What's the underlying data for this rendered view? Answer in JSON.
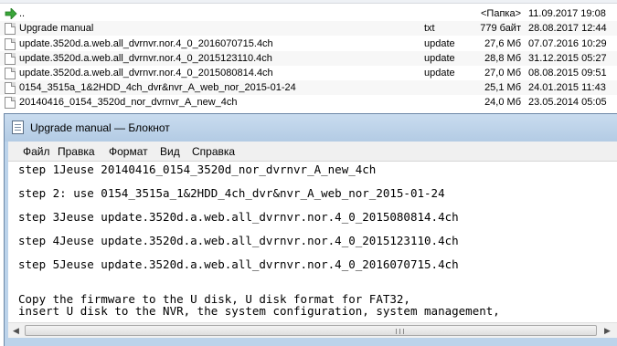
{
  "file_manager": {
    "rows": [
      {
        "name": "..",
        "type": "",
        "size": "<Папка>",
        "date": "11.09.2017 19:08",
        "kind": "up"
      },
      {
        "name": "Upgrade manual",
        "type": "txt",
        "size": "779 байт",
        "date": "28.08.2017 12:44",
        "kind": "file"
      },
      {
        "name": "update.3520d.a.web.all_dvrnvr.nor.4_0_2016070715.4ch",
        "type": "update",
        "size": "27,6 Мб",
        "date": "07.07.2016 10:29",
        "kind": "file"
      },
      {
        "name": "update.3520d.a.web.all_dvrnvr.nor.4_0_2015123110.4ch",
        "type": "update",
        "size": "28,8 Мб",
        "date": "31.12.2015 05:27",
        "kind": "file"
      },
      {
        "name": "update.3520d.a.web.all_dvrnvr.nor.4_0_2015080814.4ch",
        "type": "update",
        "size": "27,0 Мб",
        "date": "08.08.2015 09:51",
        "kind": "file"
      },
      {
        "name": "0154_3515a_1&2HDD_4ch_dvr&nvr_A_web_nor_2015-01-24",
        "type": "",
        "size": "25,1 Мб",
        "date": "24.01.2015 11:43",
        "kind": "file"
      },
      {
        "name": "20140416_0154_3520d_nor_dvrnvr_A_new_4ch",
        "type": "",
        "size": "24,0 Мб",
        "date": "23.05.2014 05:05",
        "kind": "file"
      }
    ]
  },
  "notepad": {
    "title": "Upgrade manual — Блокнот",
    "menu": [
      "Файл",
      "Правка",
      "Формат",
      "Вид",
      "Справка"
    ],
    "lines": [
      "step 1Jeuse 20140416_0154_3520d_nor_dvrnvr_A_new_4ch",
      "step 2: use 0154_3515a_1&2HDD_4ch_dvr&nvr_A_web_nor_2015-01-24",
      "step 3Jeuse update.3520d.a.web.all_dvrnvr.nor.4_0_2015080814.4ch",
      "step 4Jeuse update.3520d.a.web.all_dvrnvr.nor.4_0_2015123110.4ch",
      "step 5Jeuse update.3520d.a.web.all_dvrnvr.nor.4_0_2016070715.4ch",
      "Copy the firmware to the U disk, U disk format for FAT32,",
      "insert U disk to the NVR, the system configuration, system management,"
    ],
    "scroll_left_glyph": "◀",
    "scroll_right_glyph": "▶"
  },
  "colors": {
    "title_bar": "#bcd3ea",
    "up_arrow": "#3aa63a"
  }
}
